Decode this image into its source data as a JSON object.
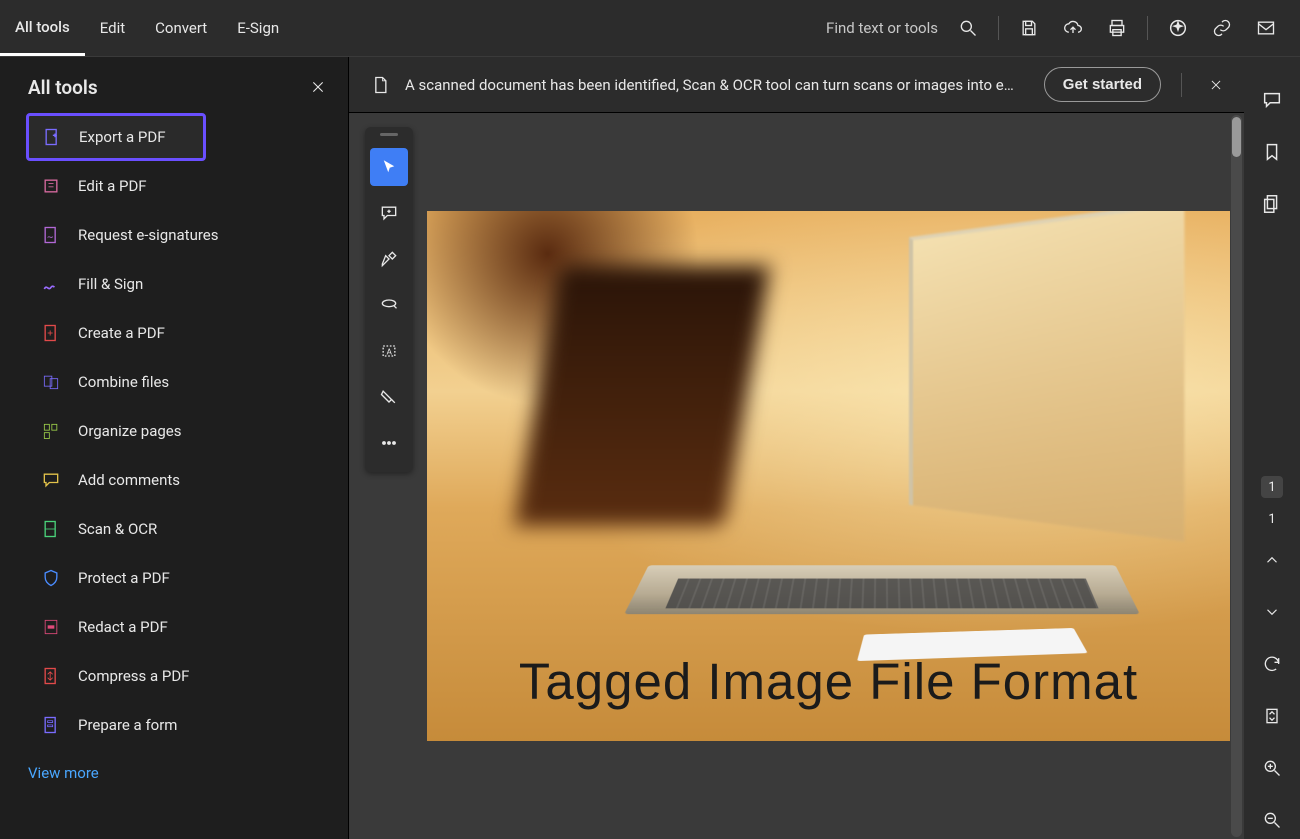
{
  "topnav": {
    "items": [
      "All tools",
      "Edit",
      "Convert",
      "E-Sign"
    ],
    "active": 0
  },
  "topbar": {
    "search_placeholder": "Find text or tools"
  },
  "sidebar": {
    "title": "All tools",
    "items": [
      {
        "label": "Export a PDF",
        "icon": "export-pdf-icon",
        "color": "#7a6cff",
        "highlight": true
      },
      {
        "label": "Edit a PDF",
        "icon": "edit-pdf-icon",
        "color": "#d86aa0"
      },
      {
        "label": "Request e-signatures",
        "icon": "signature-icon",
        "color": "#b268d6"
      },
      {
        "label": "Fill & Sign",
        "icon": "fill-sign-icon",
        "color": "#9a6cff"
      },
      {
        "label": "Create a PDF",
        "icon": "create-pdf-icon",
        "color": "#e24a4a"
      },
      {
        "label": "Combine files",
        "icon": "combine-icon",
        "color": "#7a6cff"
      },
      {
        "label": "Organize pages",
        "icon": "organize-icon",
        "color": "#9fd24a"
      },
      {
        "label": "Add comments",
        "icon": "comment-icon",
        "color": "#e2c24a"
      },
      {
        "label": "Scan & OCR",
        "icon": "scan-ocr-icon",
        "color": "#4ad27a"
      },
      {
        "label": "Protect a PDF",
        "icon": "protect-icon",
        "color": "#4a8cff"
      },
      {
        "label": "Redact a PDF",
        "icon": "redact-icon",
        "color": "#e24a7a"
      },
      {
        "label": "Compress a PDF",
        "icon": "compress-icon",
        "color": "#e24a4a"
      },
      {
        "label": "Prepare a form",
        "icon": "form-icon",
        "color": "#7a6cff"
      }
    ],
    "view_more": "View more"
  },
  "banner": {
    "message": "A scanned document has been identified, Scan & OCR tool can turn scans or images into e…",
    "cta": "Get started"
  },
  "document": {
    "caption": "Tagged Image File Format"
  },
  "paging": {
    "current": "1",
    "total": "1"
  }
}
